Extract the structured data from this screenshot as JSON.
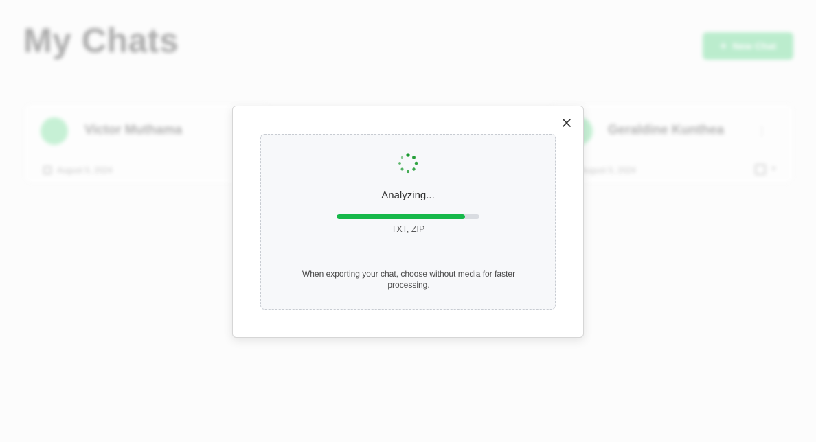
{
  "page": {
    "title": "My Chats",
    "new_chat_label": "New Chat"
  },
  "chats": [
    {
      "name": "Victor Muthama",
      "date": "August 5, 2024"
    },
    {
      "name": "Geraldine Kunthea",
      "date": "August 5, 2024"
    }
  ],
  "modal": {
    "status": "Analyzing...",
    "progress": 0.9,
    "formats": "TXT, ZIP",
    "hint": "When exporting your chat, choose without media for faster processing."
  },
  "colors": {
    "accent": "#16b84a",
    "progress_track": "#d9dce1",
    "spinner": "#1a9a2e"
  },
  "icons": [
    "plus-icon",
    "calendar-icon",
    "more-icon",
    "export-icon",
    "close-icon",
    "spinner-icon"
  ]
}
